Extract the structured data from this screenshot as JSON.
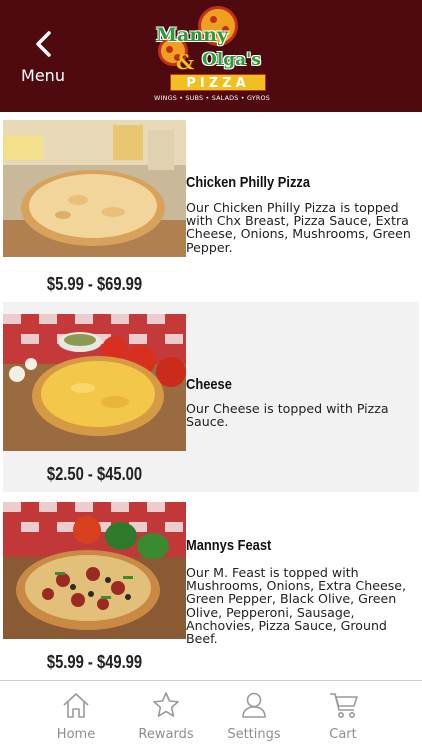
{
  "header": {
    "back_label": "Menu",
    "logo": {
      "line1": "Manny",
      "amp": "&",
      "line2": "Olga's",
      "pizza": "PIZZA",
      "tagline": "WINGS • SUBS • SALADS • GYROS"
    },
    "background_color": "#4e0a0f"
  },
  "menu_items": [
    {
      "name": "Chicken Philly Pizza",
      "description": "Our Chicken Philly Pizza is topped with Chx Breast, Pizza Sauce, Extra Cheese, Onions, Mushrooms, Green Pepper.",
      "price": "$5.99 - $69.99",
      "image": "chicken-philly-pizza-photo"
    },
    {
      "name": "Cheese",
      "description": "Our Cheese is topped with Pizza Sauce.",
      "price": "$2.50 - $45.00",
      "image": "cheese-pizza-photo"
    },
    {
      "name": "Mannys Feast",
      "description": "Our M. Feast is topped with Mushrooms, Onions, Extra Cheese, Green Pepper, Black Olive, Green Olive, Pepperoni, Sausage, Anchovies, Pizza Sauce, Ground Beef.",
      "price": "$5.99 - $49.99",
      "image": "mannys-feast-pizza-photo"
    }
  ],
  "tabbar": {
    "tabs": [
      {
        "label": "Home",
        "icon": "home-icon"
      },
      {
        "label": "Rewards",
        "icon": "star-icon"
      },
      {
        "label": "Settings",
        "icon": "person-icon"
      },
      {
        "label": "Cart",
        "icon": "cart-icon"
      }
    ]
  }
}
